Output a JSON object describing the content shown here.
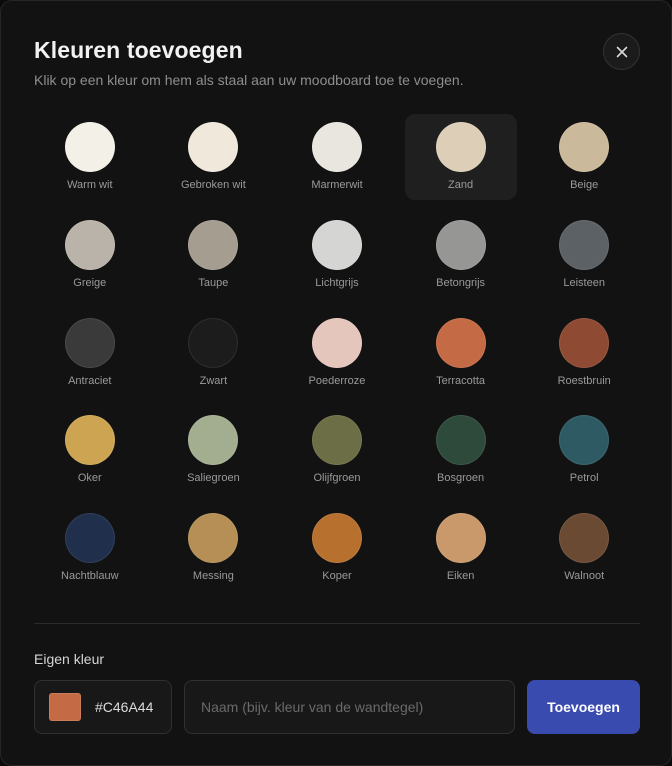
{
  "dialog": {
    "title": "Kleuren toevoegen",
    "subtitle": "Klik op een kleur om hem als staal aan uw moodboard toe te voegen.",
    "close_icon": "close-icon"
  },
  "swatches": [
    {
      "label": "Warm wit",
      "color": "#F3F0E8",
      "selected": false
    },
    {
      "label": "Gebroken wit",
      "color": "#EFE8DB",
      "selected": false
    },
    {
      "label": "Marmerwit",
      "color": "#E9E6E0",
      "selected": false
    },
    {
      "label": "Zand",
      "color": "#DDCFB7",
      "selected": true
    },
    {
      "label": "Beige",
      "color": "#CBB99B",
      "selected": false
    },
    {
      "label": "Greige",
      "color": "#BAB3A9",
      "selected": false
    },
    {
      "label": "Taupe",
      "color": "#A69D91",
      "selected": false
    },
    {
      "label": "Lichtgrijs",
      "color": "#D5D5D3",
      "selected": false
    },
    {
      "label": "Betongrijs",
      "color": "#969695",
      "selected": false
    },
    {
      "label": "Leisteen",
      "color": "#5C6166",
      "selected": false
    },
    {
      "label": "Antraciet",
      "color": "#3A3A3A",
      "selected": false
    },
    {
      "label": "Zwart",
      "color": "#1C1C1C",
      "selected": false
    },
    {
      "label": "Poederroze",
      "color": "#E5C6BD",
      "selected": false
    },
    {
      "label": "Terracotta",
      "color": "#C46A44",
      "selected": false
    },
    {
      "label": "Roestbruin",
      "color": "#8E4A33",
      "selected": false
    },
    {
      "label": "Oker",
      "color": "#CDA552",
      "selected": false
    },
    {
      "label": "Saliegroen",
      "color": "#A3AE91",
      "selected": false
    },
    {
      "label": "Olijfgroen",
      "color": "#6C6E45",
      "selected": false
    },
    {
      "label": "Bosgroen",
      "color": "#2E4A3A",
      "selected": false
    },
    {
      "label": "Petrol",
      "color": "#2D5A63",
      "selected": false
    },
    {
      "label": "Nachtblauw",
      "color": "#202F4C",
      "selected": false
    },
    {
      "label": "Messing",
      "color": "#B58F55",
      "selected": false
    },
    {
      "label": "Koper",
      "color": "#B8702F",
      "selected": false
    },
    {
      "label": "Eiken",
      "color": "#C9996B",
      "selected": false
    },
    {
      "label": "Walnoot",
      "color": "#6B4A33",
      "selected": false
    }
  ],
  "custom": {
    "label": "Eigen kleur",
    "hex_value": "#C46A44",
    "chip_color": "#C46A44",
    "name_placeholder": "Naam (bijv. kleur van de wandtegel)",
    "name_value": "",
    "add_label": "Toevoegen",
    "add_color": "#3A4BB0"
  }
}
